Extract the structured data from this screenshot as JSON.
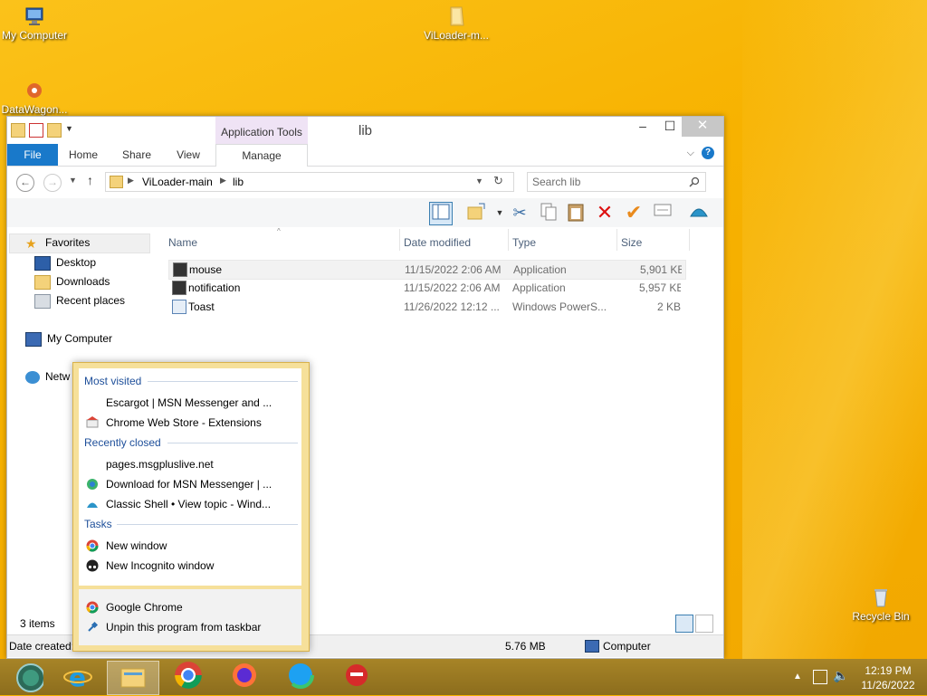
{
  "desktop": {
    "icons": [
      {
        "label": "My Computer"
      },
      {
        "label": "ViLoader-m..."
      },
      {
        "label": "DataWagon..."
      },
      {
        "label": "Recycle Bin"
      }
    ]
  },
  "window": {
    "title": "lib",
    "context_tab": "Application Tools",
    "controls": {
      "minimize": "–",
      "maximize": "☐",
      "close": "✕"
    }
  },
  "ribbon": {
    "tabs": [
      "File",
      "Home",
      "Share",
      "View",
      "Manage"
    ]
  },
  "address": {
    "path": [
      "ViLoader-main",
      "lib"
    ],
    "search_placeholder": "Search lib"
  },
  "navpane": {
    "favorites": "Favorites",
    "items": [
      "Desktop",
      "Downloads",
      "Recent places"
    ],
    "computer": "My Computer",
    "network": "Netw"
  },
  "file_list": {
    "columns": [
      "Name",
      "Date modified",
      "Type",
      "Size"
    ],
    "rows": [
      {
        "name": "mouse",
        "date": "11/15/2022 2:06 AM",
        "type": "Application",
        "size": "5,901 KB"
      },
      {
        "name": "notification",
        "date": "11/15/2022 2:06 AM",
        "type": "Application",
        "size": "5,957 KB"
      },
      {
        "name": "Toast",
        "date": "11/26/2022 12:12 ...",
        "type": "Windows PowerS...",
        "size": "2 KB"
      }
    ]
  },
  "status": {
    "item_count": "3 items",
    "date_created": "Date created:",
    "total_size": "5.76 MB",
    "location": "Computer"
  },
  "jumplist": {
    "most_visited_heading": "Most visited",
    "most_visited": [
      "Escargot | MSN Messenger and ...",
      "Chrome Web Store - Extensions"
    ],
    "recently_closed_heading": "Recently closed",
    "recently_closed": [
      "pages.msgpluslive.net",
      "Download for MSN Messenger | ...",
      "Classic Shell • View topic - Wind..."
    ],
    "tasks_heading": "Tasks",
    "tasks": [
      "New window",
      "New Incognito window"
    ],
    "pinned": [
      "Google Chrome",
      "Unpin this program from taskbar"
    ]
  },
  "taskbar": {
    "time": "12:19 PM",
    "date": "11/26/2022"
  }
}
